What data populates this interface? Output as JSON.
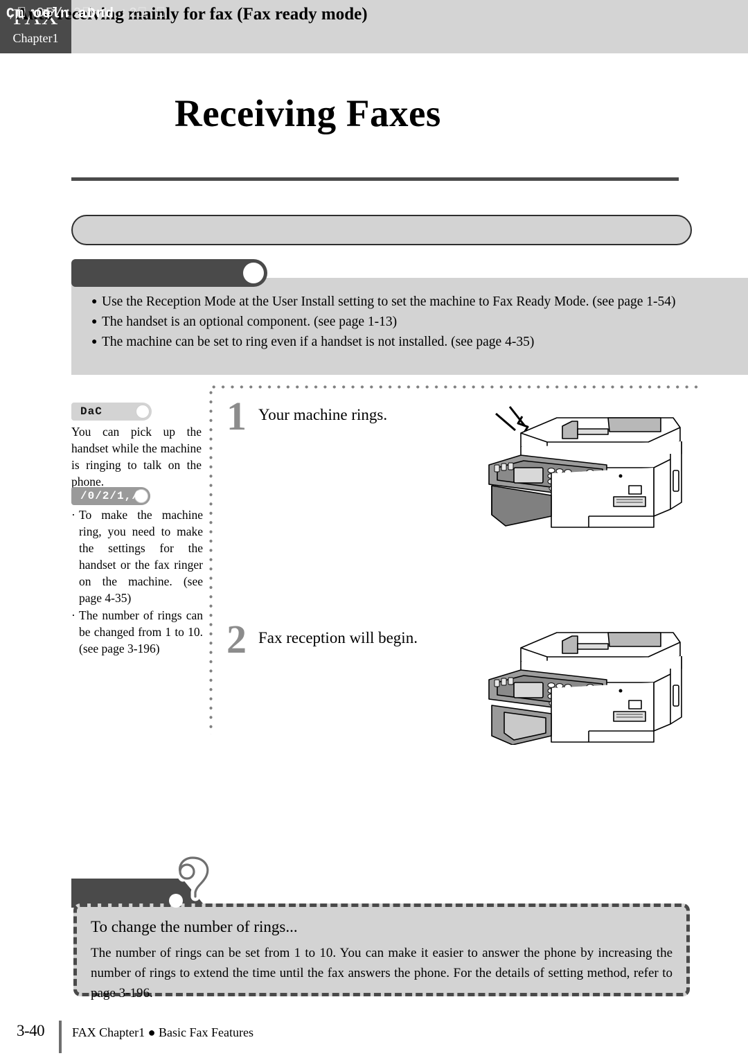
{
  "header": {
    "tab_title": "FAX",
    "tab_chapter": "Chapter1"
  },
  "page_title": "Receiving Faxes",
  "section": {
    "heading": "Auto receiving mainly for fax (Fax ready mode)",
    "note_tag_label": ",⎕ 05/:2⎕ 1  :2⎕ ⎕",
    "notes": [
      {
        "bullet": "●",
        "text": "Use the Reception Mode at the User Install setting to set the machine to Fax Ready Mode. (see page 1-54)"
      },
      {
        "bullet": "●",
        "text": "The handset is an optional component. (see page 1-13)"
      },
      {
        "bullet": "●",
        "text": "The machine can be set to ring even if a handset is not installed. (see page 4-35)"
      }
    ]
  },
  "steps": [
    {
      "number": "1",
      "text": "Your machine rings."
    },
    {
      "number": "2",
      "text": "Fax reception will begin."
    }
  ],
  "sidebar": {
    "tag1_label": "DaC",
    "note1": "You can pick up the handset while the machine is ringing to talk on the phone.",
    "tag2_label": "/0/2/1,/",
    "bullets": [
      {
        "marker": "·",
        "text": "To make the machine ring, you need to make the settings for the handset or the fax ringer on the machine. (see page 4-35)"
      },
      {
        "marker": "·",
        "text": "The number of rings can be changed from 1 to 10. (see page 3-196)"
      }
    ]
  },
  "tip": {
    "tag_label": "Cm oeln aDnd",
    "heading": "To change the number of rings...",
    "body": "The number of rings can be set from 1 to 10. You can make it easier to answer the phone by increasing the number of rings to extend the time until the fax answers the phone. For the details of setting method, refer to page 3-196."
  },
  "footer": {
    "page_number": "3-40",
    "text": "FAX Chapter1 ● Basic Fax Features"
  },
  "colors": {
    "dark_gray": "#4a4a4a",
    "header_band": "#d4d4d4",
    "panel_gray": "#d3d3d3",
    "step_number_gray": "#8c8c8c",
    "tag_mid_gray": "#9a9a9a"
  }
}
